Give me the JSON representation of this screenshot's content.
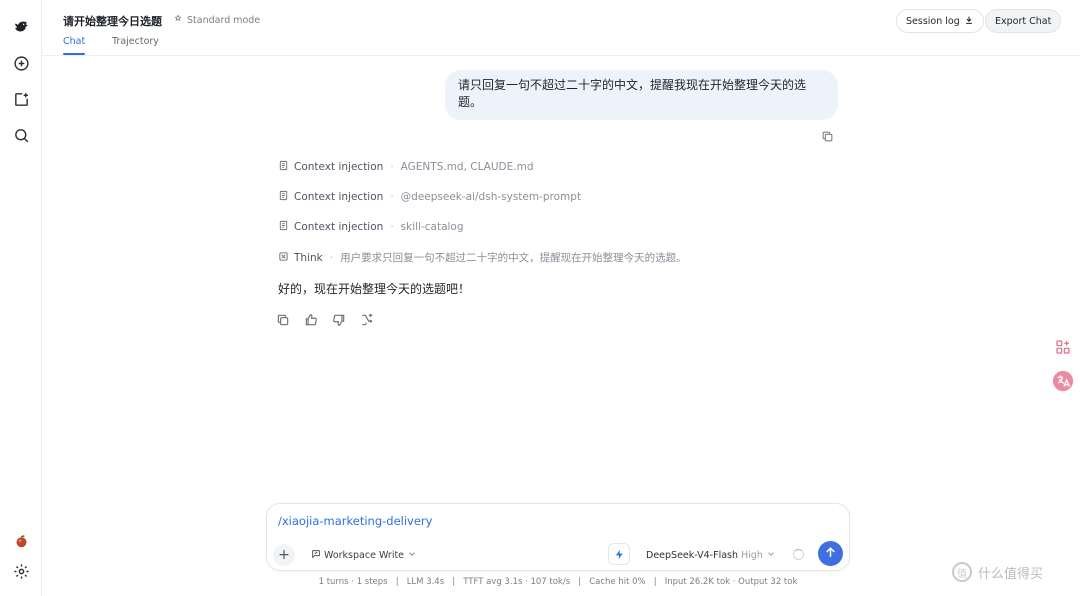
{
  "header": {
    "title": "请开始整理今日选题",
    "mode_label": "Standard mode",
    "tabs": [
      {
        "label": "Chat"
      },
      {
        "label": "Trajectory"
      }
    ],
    "session_log_label": "Session log",
    "export_label": "Export Chat"
  },
  "rail": {
    "icons": [
      "logo-icon",
      "new-chat-icon",
      "add-project-icon",
      "search-icon",
      "avatar-icon",
      "settings-icon"
    ]
  },
  "conversation": {
    "user_message": "请只回复一句不超过二十字的中文，提醒我现在开始整理今天的选题。",
    "context_rows": [
      {
        "label": "Context injection",
        "detail": "AGENTS.md, CLAUDE.md"
      },
      {
        "label": "Context injection",
        "detail": "@deepseek-ai/dsh-system-prompt"
      },
      {
        "label": "Context injection",
        "detail": "skill-catalog"
      }
    ],
    "think": {
      "label": "Think",
      "detail": "用户要求只回复一句不超过二十字的中文，提醒现在开始整理今天的选题。"
    },
    "assistant_answer": "好的，现在开始整理今天的选题吧！"
  },
  "composer": {
    "input_value": "/xiaojia-marketing-delivery",
    "workspace_label": "Workspace Write",
    "model_name": "DeepSeek-V4-Flash",
    "model_level": "High"
  },
  "stats": {
    "text": "1 turns · 1 steps   |   LLM 3.4s   |   TTFT avg 3.1s · 107 tok/s   |   Cache hit 0%   |   Input 26.2K tok · Output 32 tok"
  },
  "watermark": {
    "text": "什么值得买",
    "mark": "值"
  },
  "colors": {
    "accent": "#2f6fe4",
    "user_bubble": "#eef2fb",
    "send_button": "#3f6fe0"
  }
}
